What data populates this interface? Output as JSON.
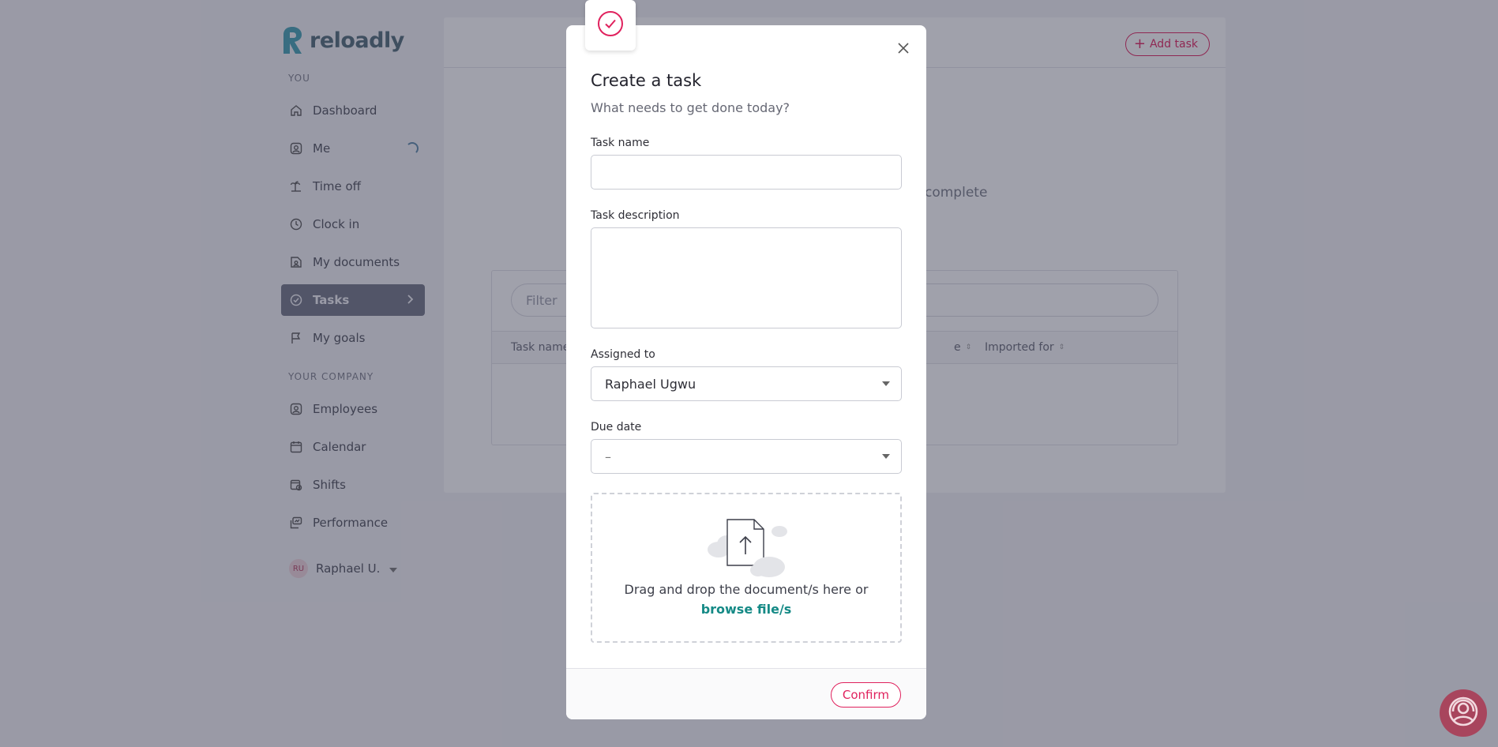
{
  "brand": {
    "name": "reloadly",
    "accent": "#e0215d",
    "link": "#158a86"
  },
  "sidebar": {
    "section_you": "YOU",
    "items": [
      {
        "label": "Dashboard",
        "icon": "home-icon"
      },
      {
        "label": "Me",
        "icon": "user-square-icon",
        "loading": true
      },
      {
        "label": "Time off",
        "icon": "palm-tree-icon"
      },
      {
        "label": "Clock in",
        "icon": "clock-icon"
      },
      {
        "label": "My documents",
        "icon": "document-user-icon"
      },
      {
        "label": "Tasks",
        "icon": "check-circle-icon",
        "active": true
      },
      {
        "label": "My goals",
        "icon": "flag-icon"
      }
    ],
    "section_company": "YOUR COMPANY",
    "company_items": [
      {
        "label": "Employees",
        "icon": "employees-icon"
      },
      {
        "label": "Calendar",
        "icon": "calendar-icon"
      },
      {
        "label": "Shifts",
        "icon": "shifts-icon"
      },
      {
        "label": "Performance",
        "icon": "performance-icon"
      }
    ],
    "user": {
      "initials": "RU",
      "name": "Raphael U."
    }
  },
  "main": {
    "add_task_label": "Add task",
    "progress_fragment": "complete",
    "filter_placeholder": "Filter",
    "columns": {
      "task_name": "Task name",
      "e_fragment": "e",
      "imported_for": "Imported for"
    }
  },
  "modal": {
    "title": "Create a task",
    "subtitle": "What needs to get done today?",
    "task_name_label": "Task name",
    "task_name_value": "",
    "task_description_label": "Task description",
    "task_description_value": "",
    "assigned_to_label": "Assigned to",
    "assigned_to_value": "Raphael Ugwu",
    "due_date_label": "Due date",
    "due_date_value": "–",
    "dropzone_text": "Drag and drop the document/s here or",
    "dropzone_link": "browse file/s",
    "confirm_label": "Confirm"
  }
}
